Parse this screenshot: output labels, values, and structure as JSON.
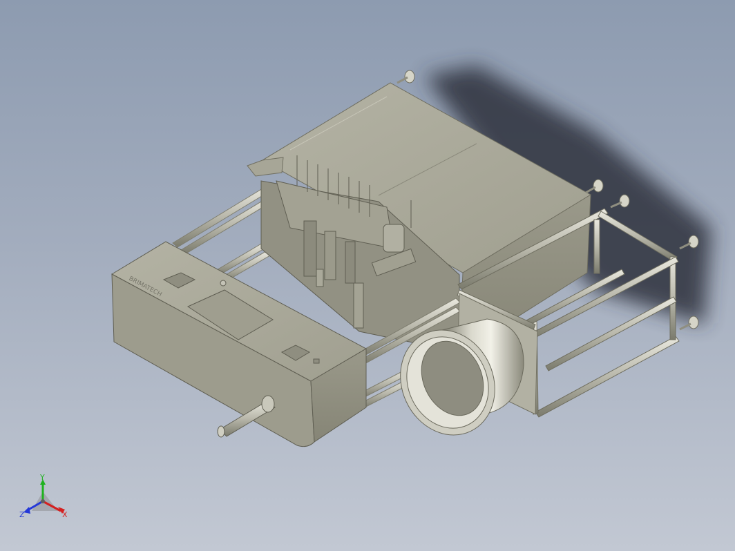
{
  "viewport": {
    "background_top": "#8d9bb0",
    "background_bottom": "#c2c8d3"
  },
  "model": {
    "material_color": "#a6a596",
    "edge_color": "#6f6e60",
    "shadow_color": "#3a3f4a",
    "panel_text": "BRIMATECH"
  },
  "triad": {
    "x_label": "X",
    "y_label": "Y",
    "z_label": "Z",
    "x_color": "#d42020",
    "y_color": "#1fb21f",
    "z_color": "#2438d8"
  }
}
